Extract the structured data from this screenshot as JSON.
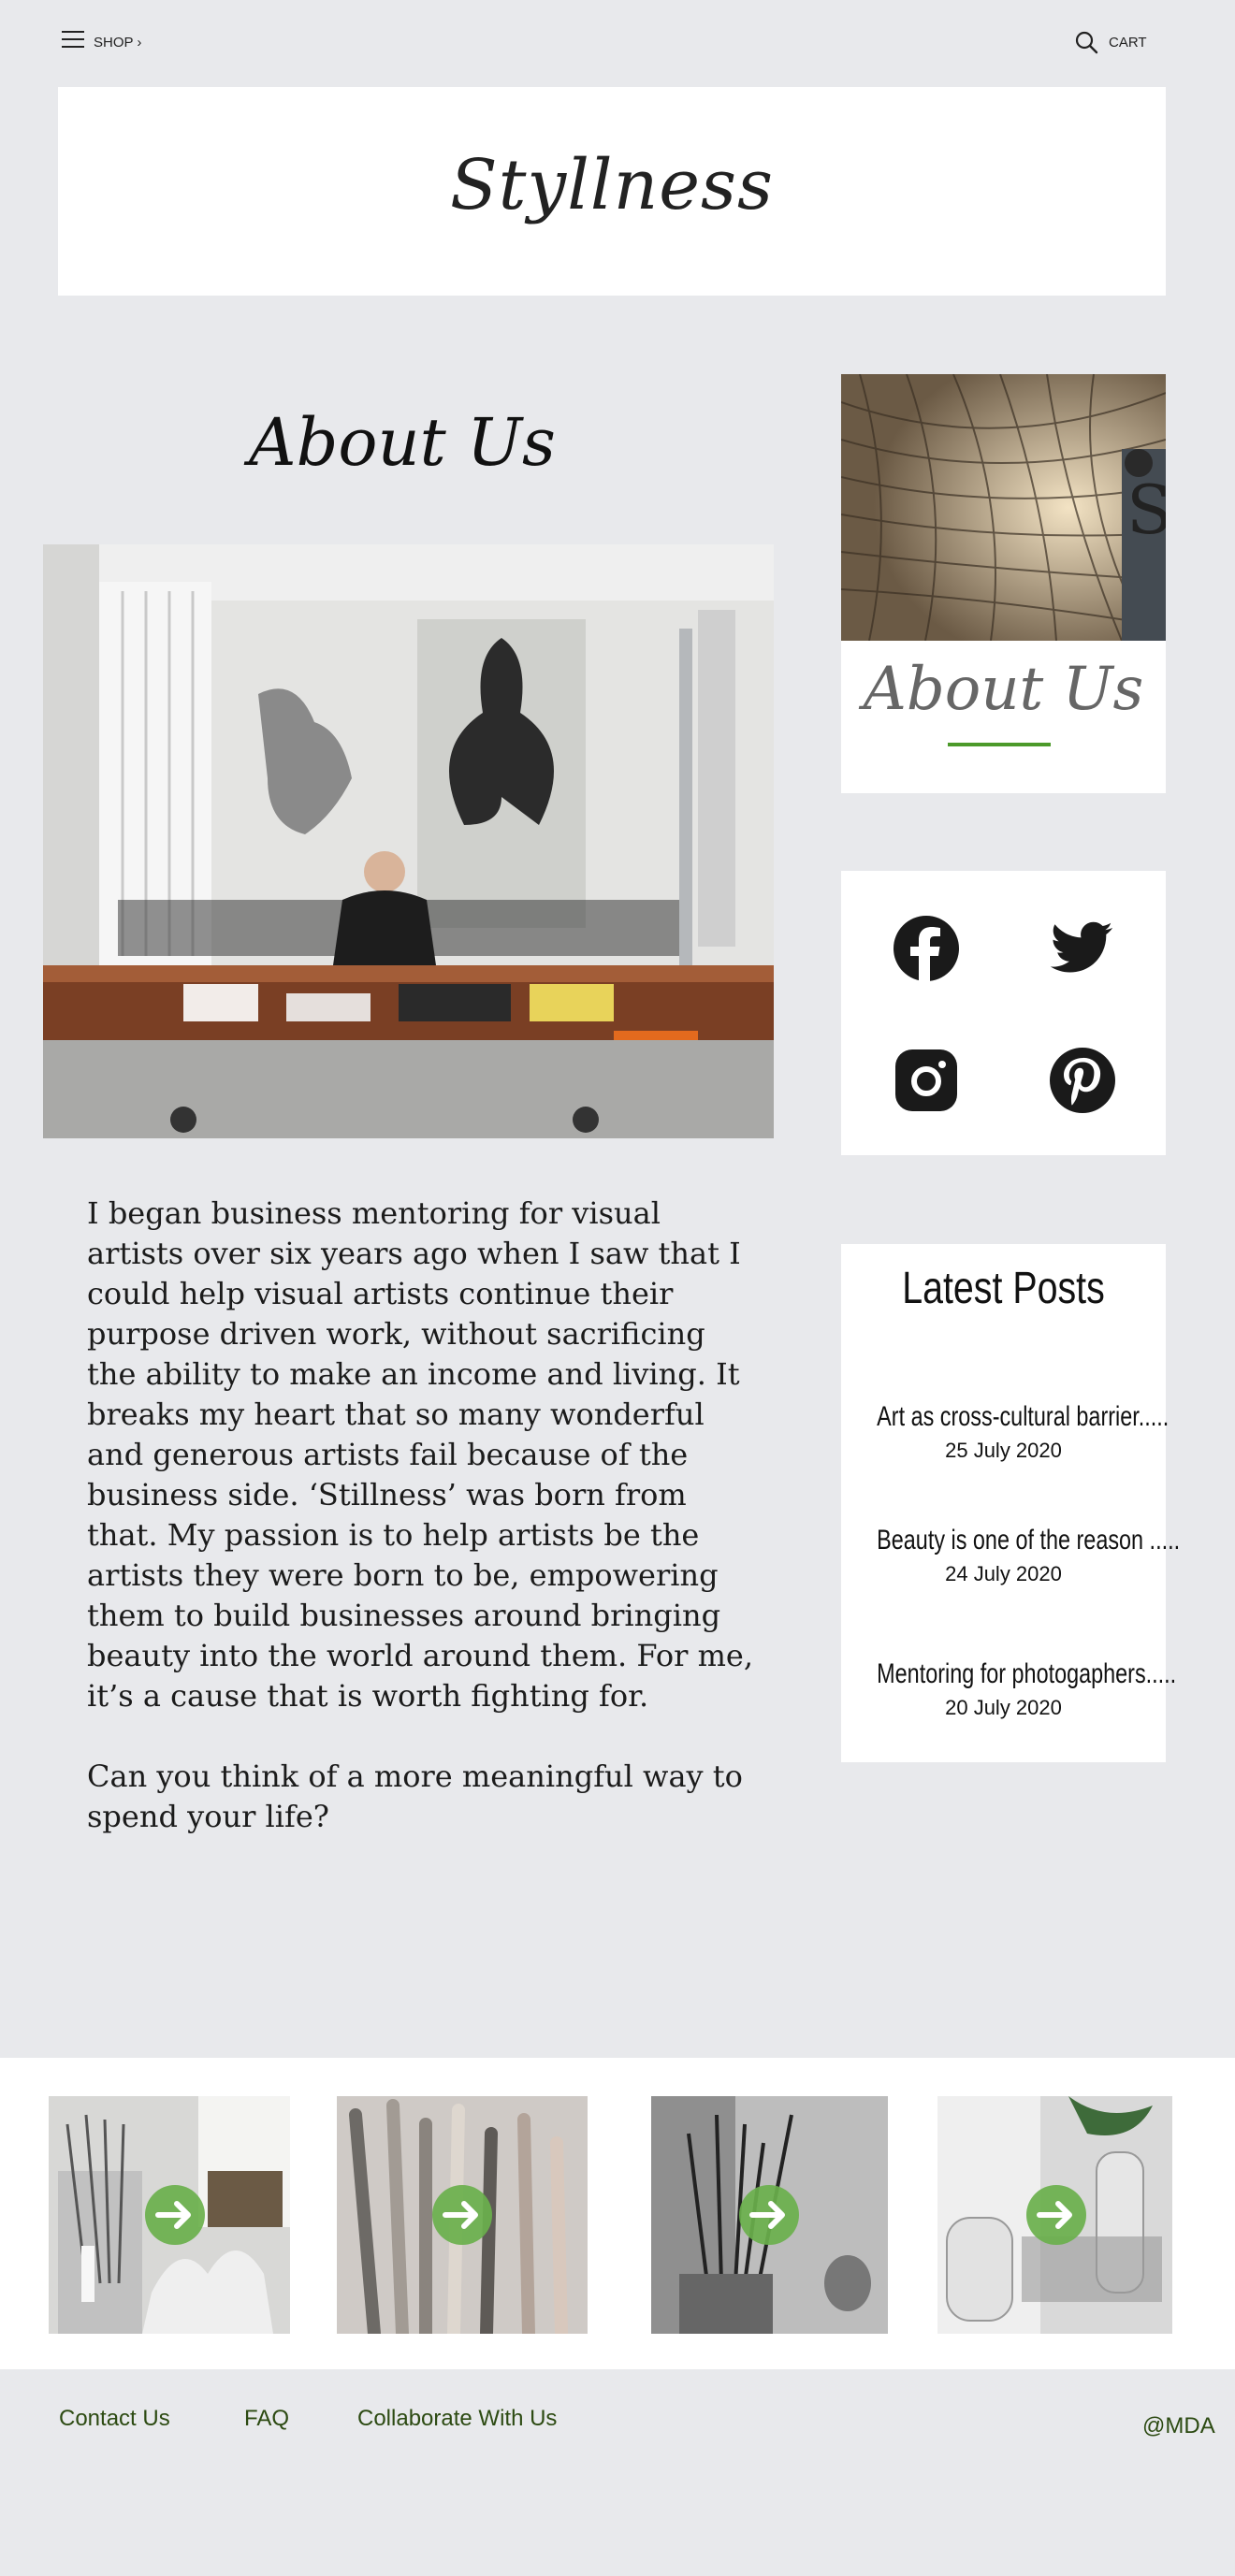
{
  "header": {
    "shop_label": "SHOP ›",
    "cart_label": "CART",
    "site_title": "Styllness"
  },
  "main": {
    "heading": "About Us",
    "paragraphs": [
      "I began business mentoring for visual artists over six years ago when I saw that I could help visual artists continue their purpose driven work, without sacrificing the ability to make an income and living. It breaks my heart that so many wonderful and generous artists fail because of the business side. ‘Stillness’ was born from that. My passion is to help artists be the artists they were born to be, empowering them to build businesses around bringing beauty into the world around them. For me, it’s a cause that is worth fighting for.",
      "Can you think of a more meaningful way to spend your life?"
    ]
  },
  "sidebar": {
    "about_card_title": "About Us",
    "about_card_image_text": "S",
    "social_icons": [
      "facebook-icon",
      "twitter-icon",
      "instagram-icon",
      "pinterest-icon"
    ],
    "latest_posts_title": "Latest Posts",
    "posts": [
      {
        "title": "Art as cross-cultural barrier.....",
        "date": "25 July 2020"
      },
      {
        "title": "Beauty is one of the reason .....",
        "date": "24 July 2020"
      },
      {
        "title": "Mentoring for photogaphers.....",
        "date": "20 July 2020"
      }
    ]
  },
  "gallery": {
    "items": [
      "arrow-right-icon",
      "arrow-right-icon",
      "arrow-right-icon",
      "arrow-right-icon"
    ]
  },
  "footer": {
    "links": [
      "Contact Us",
      "FAQ",
      "Collaborate With Us"
    ],
    "credit": "@MDA"
  },
  "colors": {
    "background": "#e8e9ec",
    "accent_green": "#4c9a2a",
    "arrow_green": "#6ab04c",
    "footer_link": "#2c4a12"
  }
}
